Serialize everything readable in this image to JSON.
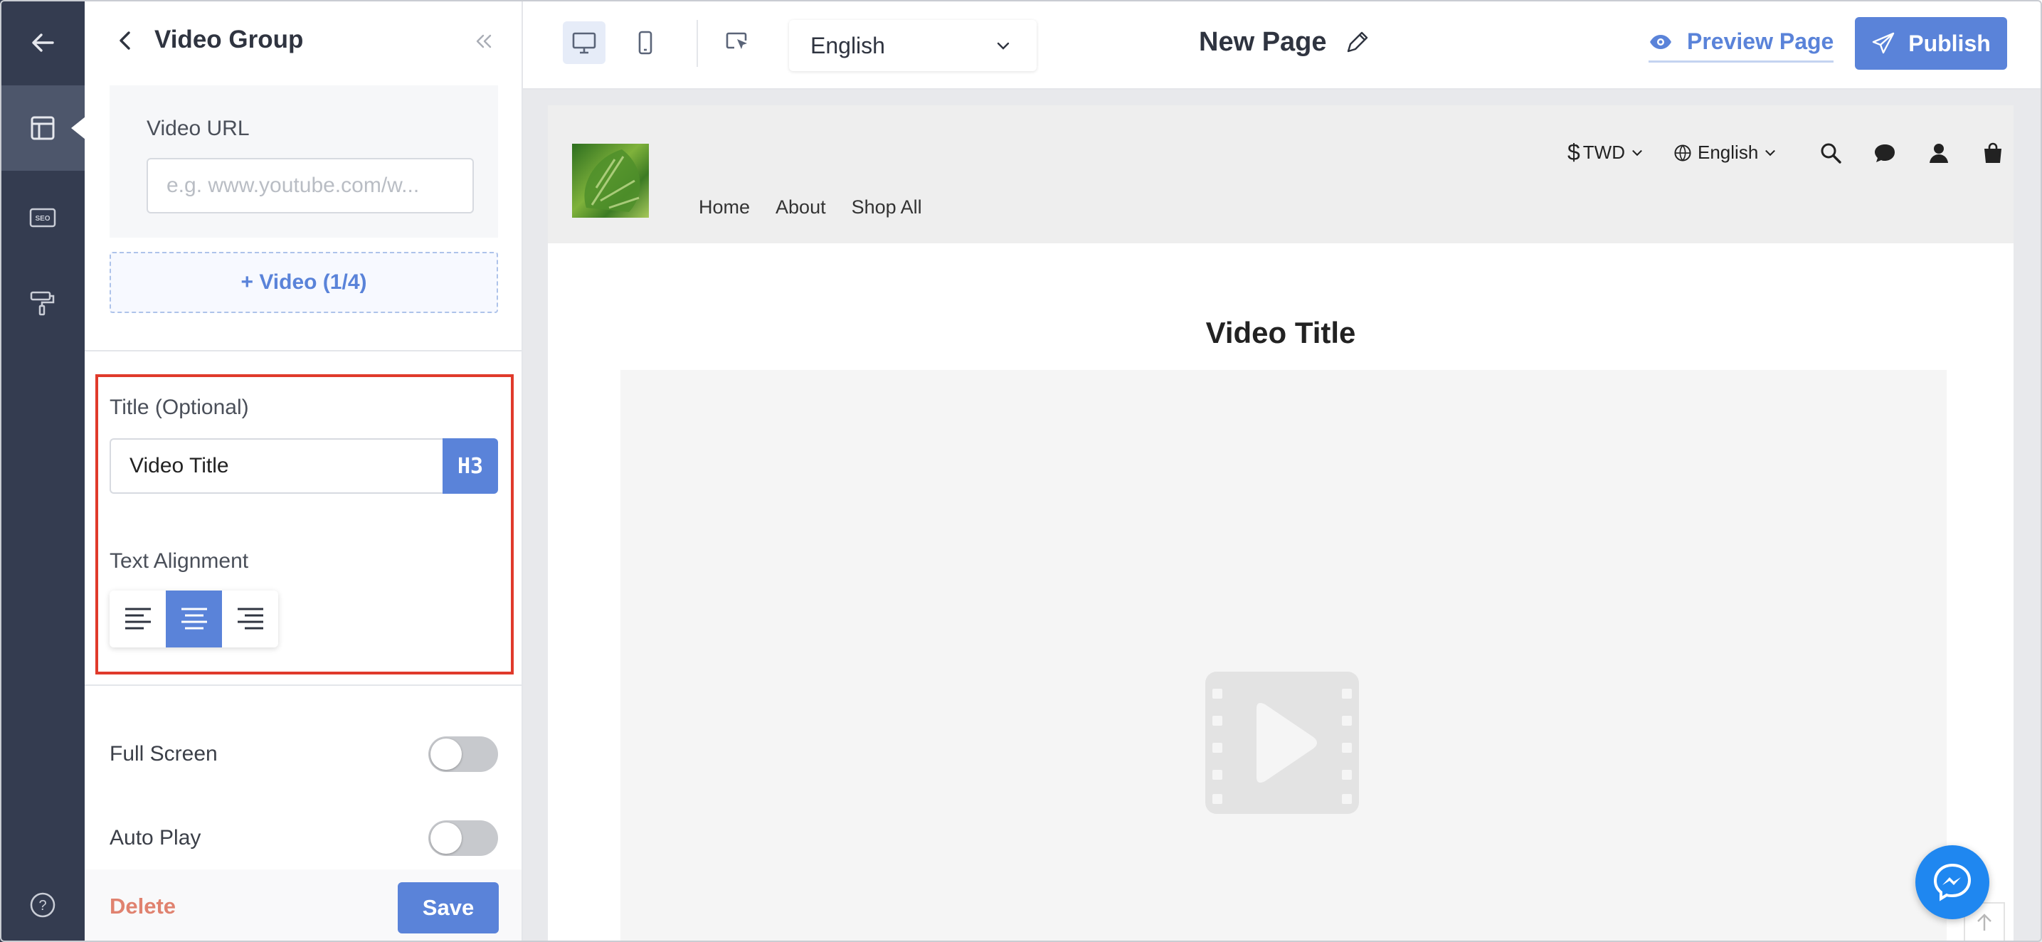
{
  "rail": {
    "items": [
      "back-arrow-icon",
      "layout-icon",
      "seo-icon",
      "paint-roller-icon",
      "help-icon"
    ],
    "seo_label": "SEO",
    "help_label": "?"
  },
  "panel": {
    "title": "Video Group",
    "video_url": {
      "label": "Video URL",
      "value": "",
      "placeholder": "e.g. www.youtube.com/w..."
    },
    "add_video": "+ Video (1/4)",
    "title_field": {
      "label": "Title (Optional)",
      "value": "Video Title",
      "heading_level": "H3"
    },
    "text_alignment": {
      "label": "Text Alignment",
      "options": [
        "left",
        "center",
        "right"
      ],
      "selected": "center"
    },
    "toggles": [
      {
        "label": "Full Screen",
        "on": false
      },
      {
        "label": "Auto Play",
        "on": false
      }
    ],
    "delete_label": "Delete",
    "save_label": "Save"
  },
  "topbar": {
    "language": "English",
    "page_name": "New Page",
    "preview_label": "Preview Page",
    "publish_label": "Publish"
  },
  "store": {
    "nav": [
      "Home",
      "About",
      "Shop All"
    ],
    "currency": "TWD",
    "language": "English",
    "video_title": "Video Title"
  },
  "colors": {
    "rail": "#343c50",
    "accent": "#5a83d9",
    "delete": "#e0826f",
    "highlight_border": "#e03a2b",
    "messenger": "#1f87f0"
  }
}
